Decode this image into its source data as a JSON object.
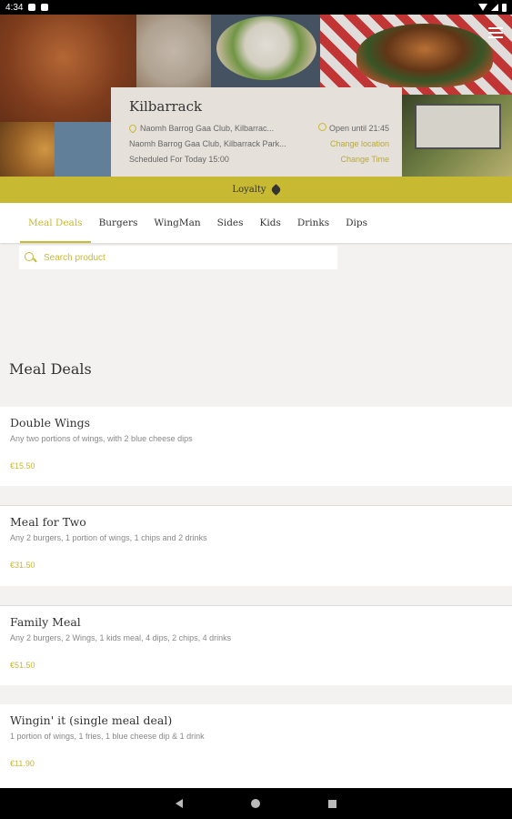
{
  "status_bar": {
    "time": "4:34"
  },
  "store": {
    "name": "Kilbarrack",
    "address": "Naomh Barrog Gaa Club, Kilbarrac...",
    "address_full": "Naomh Barrog Gaa Club, Kilbarrack Park...",
    "scheduled": "Scheduled For Today 15:00",
    "open_until": "Open until 21:45",
    "change_location": "Change location",
    "change_time": "Change Time"
  },
  "loyalty": {
    "label": "Loyalty"
  },
  "tabs": [
    "Meal Deals",
    "Burgers",
    "WingMan",
    "Sides",
    "Kids",
    "Drinks",
    "Dips"
  ],
  "search": {
    "placeholder": "Search product"
  },
  "section": {
    "title": "Meal Deals"
  },
  "products": [
    {
      "name": "Double Wings",
      "description": "Any two portions of wings, with 2 blue cheese dips",
      "price": "€15.50"
    },
    {
      "name": "Meal for Two",
      "description": "Any 2 burgers, 1 portion of wings, 1 chips and 2 drinks",
      "price": "€31.50"
    },
    {
      "name": "Family Meal",
      "description": "Any 2 burgers, 2 Wings, 1 kids meal, 4 dips, 2 chips, 4 drinks",
      "price": "€51.50"
    },
    {
      "name": "Wingin' it (single meal deal)",
      "description": "1 portion of wings, 1 fries, 1 blue cheese dip & 1 drink",
      "price": "€11.90"
    }
  ],
  "colors": {
    "accent": "#c8b933",
    "background": "#f3f2f0"
  }
}
